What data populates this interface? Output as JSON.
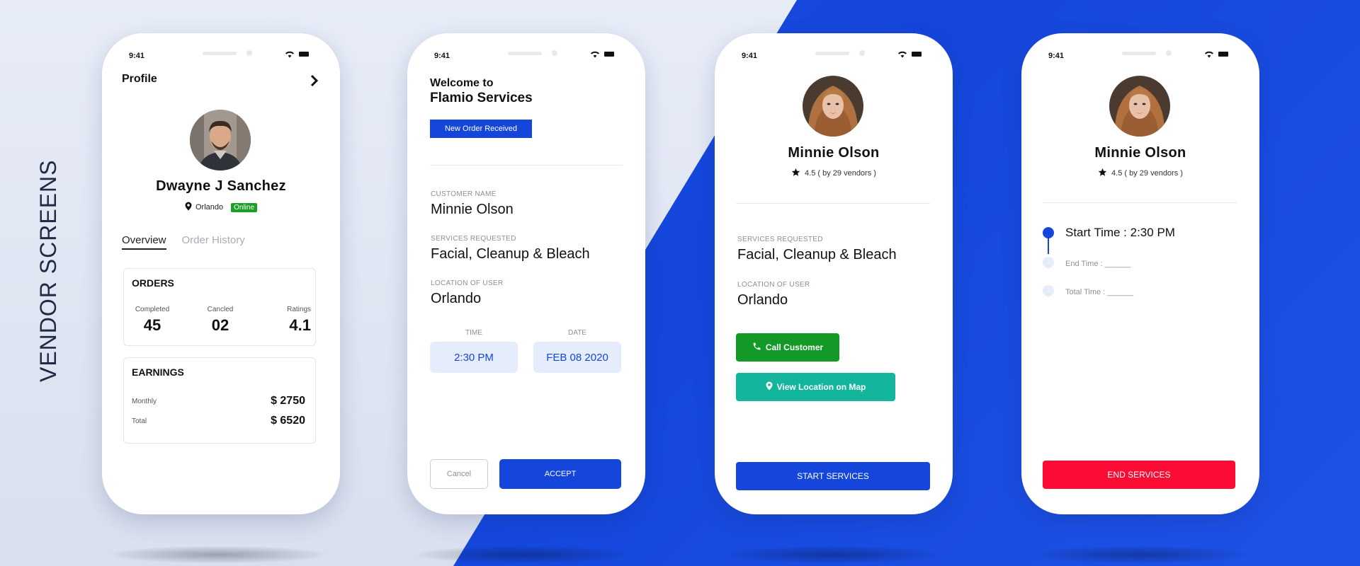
{
  "side_title": "VENDOR SCREENS",
  "status": {
    "time": "9:41"
  },
  "profile": {
    "title": "Profile",
    "name": "Dwayne J Sanchez",
    "location": "Orlando",
    "status_badge": "Online",
    "tabs": [
      "Overview",
      "Order History"
    ],
    "orders": {
      "heading": "ORDERS",
      "stats": [
        {
          "label": "Completed",
          "value": "45"
        },
        {
          "label": "Cancled",
          "value": "02"
        },
        {
          "label": "Ratings",
          "value": "4.1"
        }
      ]
    },
    "earnings": {
      "heading": "EARNINGS",
      "rows": [
        {
          "label": "Monthly",
          "value": "$ 2750"
        },
        {
          "label": "Total",
          "value": "$ 6520"
        }
      ]
    }
  },
  "new_order": {
    "welcome_line1": "Welcome to",
    "welcome_line2": "Flamio Services",
    "badge_button": "New Order Received",
    "customer_label": "CUSTOMER NAME",
    "customer_value": "Minnie Olson",
    "services_label": "SERVICES REQUESTED",
    "services_value": "Facial, Cleanup & Bleach",
    "location_label": "LOCATION OF USER",
    "location_value": "Orlando",
    "time_label": "TIME",
    "time_value": "2:30 PM",
    "date_label": "DATE",
    "date_value": "FEB 08 2020",
    "cancel_label": "Cancel",
    "accept_label": "ACCEPT"
  },
  "customer_detail": {
    "name": "Minnie Olson",
    "rating": "4.5 ( by 29 vendors )",
    "services_label": "SERVICES REQUESTED",
    "services_value": "Facial, Cleanup & Bleach",
    "location_label": "LOCATION OF USER",
    "location_value": "Orlando",
    "call_label": "Call Customer",
    "map_label": "View Location on Map",
    "start_label": "START SERVICES"
  },
  "service_timer": {
    "name": "Minnie Olson",
    "rating": "4.5 ( by 29 vendors )",
    "start_time": "Start Time : 2:30 PM",
    "end_time": "End Time : ______",
    "total_time": "Total Time : ______",
    "end_label": "END SERVICES"
  },
  "colors": {
    "primary_blue": "#1446db",
    "online_green": "#1aa027",
    "call_green": "#139a26",
    "map_teal": "#13b59c",
    "end_red": "#fb0c35"
  }
}
